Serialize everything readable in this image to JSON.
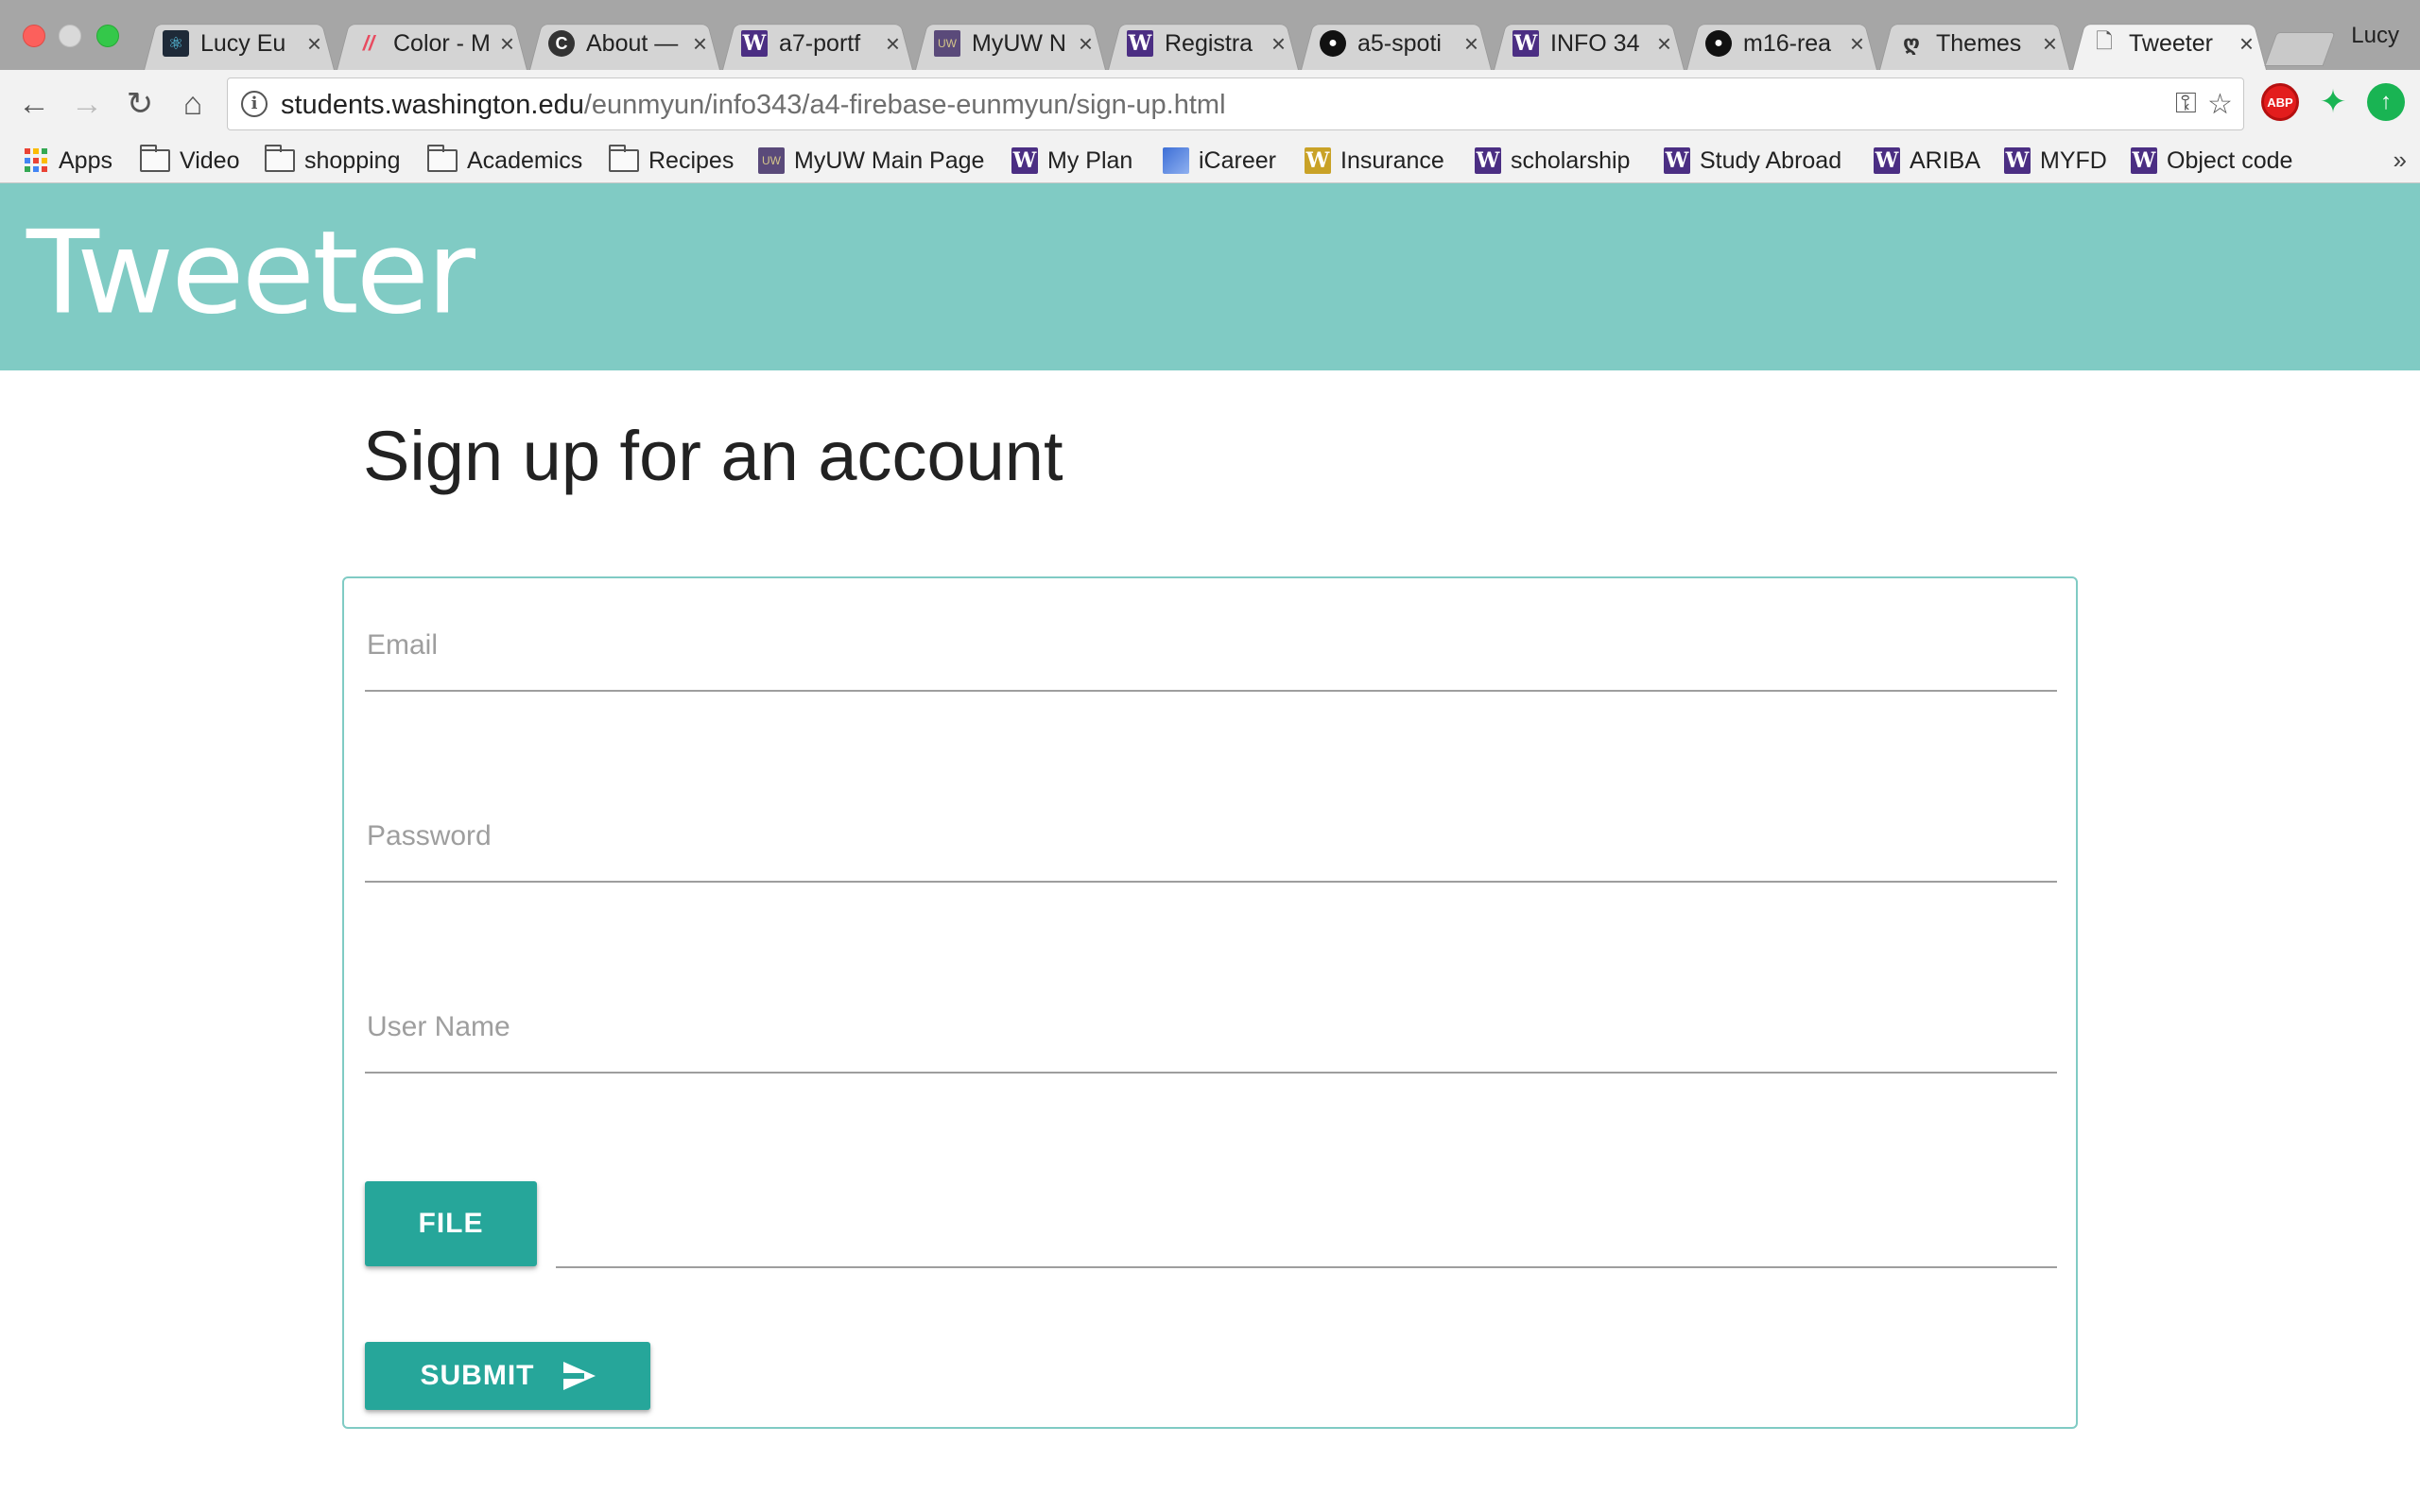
{
  "browser": {
    "profile_name": "Lucy",
    "tabs": [
      {
        "title": "Lucy Eu",
        "icon": "react-icon"
      },
      {
        "title": "Color - M",
        "icon": "color-icon"
      },
      {
        "title": "About —",
        "icon": "c-icon"
      },
      {
        "title": "a7-portf",
        "icon": "uw-w-icon"
      },
      {
        "title": "MyUW N",
        "icon": "myuw-icon"
      },
      {
        "title": "Registra",
        "icon": "uw-w-icon"
      },
      {
        "title": "a5-spoti",
        "icon": "github-icon"
      },
      {
        "title": "INFO 34",
        "icon": "uw-w-icon"
      },
      {
        "title": "m16-rea",
        "icon": "github-icon"
      },
      {
        "title": "Themes",
        "icon": "themes-icon"
      },
      {
        "title": "Tweeter",
        "icon": "page-icon"
      }
    ],
    "url_host": "students.washington.edu",
    "url_path": "/eunmyun/info343/a4-firebase-eunmyun/sign-up.html",
    "bookmarks": [
      {
        "label": "Apps",
        "icon": "apps-grid-icon"
      },
      {
        "label": "Video",
        "icon": "folder-icon"
      },
      {
        "label": "shopping",
        "icon": "folder-icon"
      },
      {
        "label": "Academics",
        "icon": "folder-icon"
      },
      {
        "label": "Recipes",
        "icon": "folder-icon"
      },
      {
        "label": "MyUW Main Page",
        "icon": "myuw-icon"
      },
      {
        "label": "My Plan",
        "icon": "uw-w-icon"
      },
      {
        "label": "iCareer",
        "icon": "icareer-icon"
      },
      {
        "label": "Insurance",
        "icon": "uw-w-gold-icon"
      },
      {
        "label": "scholarship",
        "icon": "uw-w-icon"
      },
      {
        "label": "Study Abroad",
        "icon": "uw-w-icon"
      },
      {
        "label": "ARIBA",
        "icon": "uw-w-icon"
      },
      {
        "label": "MYFD",
        "icon": "uw-w-icon"
      },
      {
        "label": "Object code",
        "icon": "uw-w-icon"
      }
    ],
    "more_glyph": "»"
  },
  "app": {
    "title": "Tweeter",
    "header_color": "#80cbc4",
    "accent_color": "#26a69a"
  },
  "page": {
    "heading": "Sign up for an account"
  },
  "form": {
    "email_label": "Email",
    "password_label": "Password",
    "username_label": "User Name",
    "file_button": "FILE",
    "file_path_value": "",
    "submit_button": "SUBMIT"
  }
}
